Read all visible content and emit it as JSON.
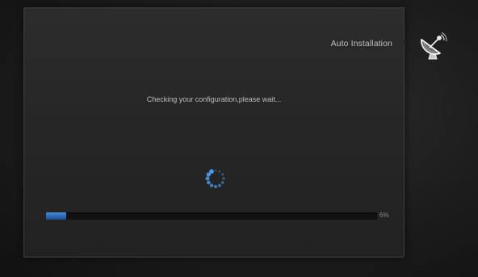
{
  "window": {
    "title": "Auto Installation"
  },
  "status": {
    "message": "Checking your configuration,please wait..."
  },
  "progress": {
    "value": 6,
    "label": "6%"
  },
  "icons": {
    "header": "satellite-dish-icon",
    "busy": "loading-spinner-icon"
  },
  "colors": {
    "accent": "#3a7fd0",
    "spinner": "#4a9ae8",
    "text": "#bfbfbf"
  }
}
